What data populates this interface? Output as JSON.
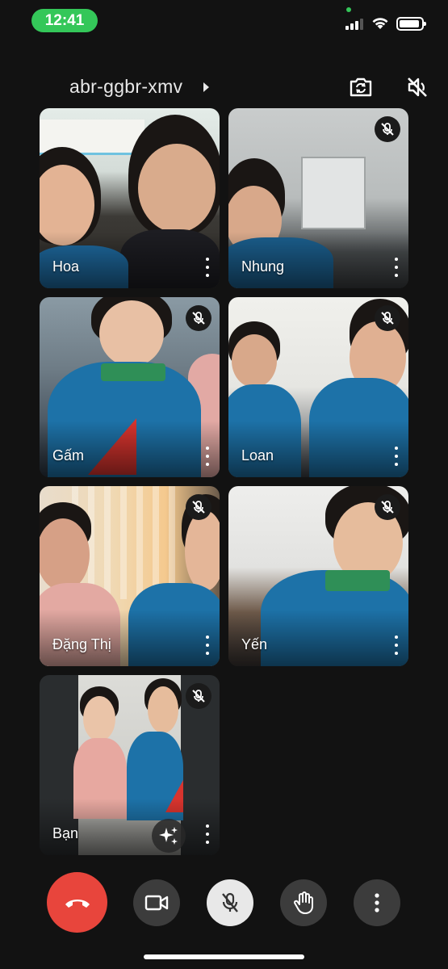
{
  "status_bar": {
    "time": "12:41"
  },
  "meeting": {
    "code": "abr-ggbr-xmv"
  },
  "participants": [
    {
      "name": "Hoa",
      "muted": false
    },
    {
      "name": "Nhung",
      "muted": true
    },
    {
      "name": "Gấm",
      "muted": true
    },
    {
      "name": "Loan",
      "muted": true
    },
    {
      "name": "Đặng Thị",
      "muted": true
    },
    {
      "name": "Yến",
      "muted": true
    },
    {
      "name": "Bạn",
      "muted": true
    }
  ],
  "controls": [
    "end-call",
    "camera",
    "microphone-muted",
    "raise-hand",
    "more-options"
  ],
  "colors": {
    "end_call": "#e8453c",
    "status_pill": "#34c759",
    "background": "#121212",
    "shirt_blue": "#1d72a8",
    "collar_green": "#2f8f57"
  }
}
